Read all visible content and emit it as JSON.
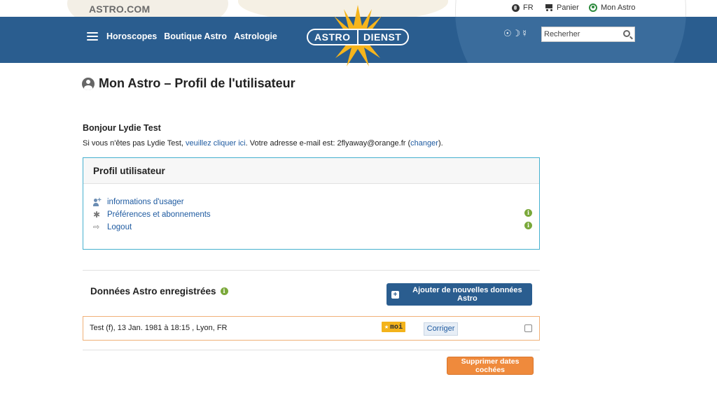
{
  "topbar": {
    "brand": "ASTRO.COM",
    "language": "FR",
    "cart": "Panier",
    "account": "Mon Astro"
  },
  "header": {
    "nav": [
      "Horoscopes",
      "Boutique Astro",
      "Astrologie"
    ],
    "logo_left": "ASTRO",
    "logo_right": "DIENST",
    "symbols": "☉☽☿",
    "search_placeholder": "Recherher"
  },
  "page": {
    "title": "Mon Astro – Profil de l'utilisateur",
    "greeting": "Bonjour Lydie Test",
    "line_prefix": "Si vous n'êtes pas Lydie Test, ",
    "line_link": "veuillez cliquer ici",
    "line_middle": ". Votre adresse e-mail est: 2flyaway@orange.fr (",
    "line_change": "changer",
    "line_suffix": ")."
  },
  "profile": {
    "heading": "Profil utilisateur",
    "items": [
      {
        "label": "informations d'usager",
        "icon": "user-add-icon"
      },
      {
        "label": "Préférences et abonnements",
        "icon": "gear-icon"
      },
      {
        "label": "Logout",
        "icon": "logout-icon"
      }
    ],
    "info_glyph": "i"
  },
  "astro_data": {
    "heading": "Données Astro enregistrées",
    "add_button": "Ajouter de nouvelles données Astro",
    "rows": [
      {
        "text": "Test (f), 13 Jan. 1981 à 18:15 , Lyon, FR",
        "badge_star": "★",
        "badge": "moi",
        "edit": "Corriger"
      }
    ],
    "delete_button": "Supprimer dates cochées"
  },
  "colors": {
    "header_blue": "#2a5d8f",
    "link_blue": "#1e5aa0",
    "box_border": "#45b0cf",
    "orange": "#ef8a3c",
    "badge_yellow": "#f3b31b",
    "info_green": "#7aa83a"
  }
}
